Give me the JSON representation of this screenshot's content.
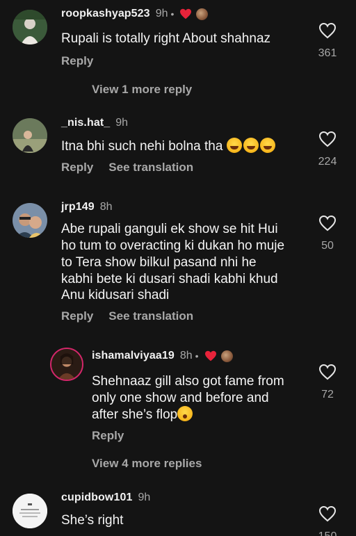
{
  "comments": [
    {
      "username": "roopkashyap523",
      "time": "9h",
      "creator_liked": true,
      "text": "Rupali is totally right About shahnaz",
      "reply": "Reply",
      "likes": "361",
      "view_more": "View 1 more reply"
    },
    {
      "username": "_nis.hat_",
      "time": "9h",
      "text": "Itna bhi such nehi bolna tha",
      "emoji": "laughing-tears x3",
      "reply": "Reply",
      "see_translation": "See translation",
      "likes": "224"
    },
    {
      "username": "jrp149",
      "time": "8h",
      "text_lines": [
        "Abe rupali ganguli ek show se hit Hui",
        "ho tum to overacting ki dukan ho muje",
        "to Tera show bilkul pasand nhi he",
        "kabhi bete ki dusari shadi kabhi khud",
        "Anu kidusari shadi"
      ],
      "reply": "Reply",
      "see_translation": "See translation",
      "likes": "50"
    },
    {
      "username": "ishamalviyaa19",
      "time": "8h",
      "creator_liked": true,
      "text_lines": [
        "Shehnaaz gill also got fame from",
        "only one show and before and",
        "after she’s flop"
      ],
      "emoji": "kissing-face",
      "reply": "Reply",
      "likes": "72",
      "view_more": "View 4 more replies"
    },
    {
      "username": "cupidbow101",
      "time": "9h",
      "text": "She’s right",
      "likes": "150"
    }
  ],
  "colors": {
    "background": "#141414",
    "heart_red": "#e8233a",
    "muted_text": "#a8a8a8"
  }
}
